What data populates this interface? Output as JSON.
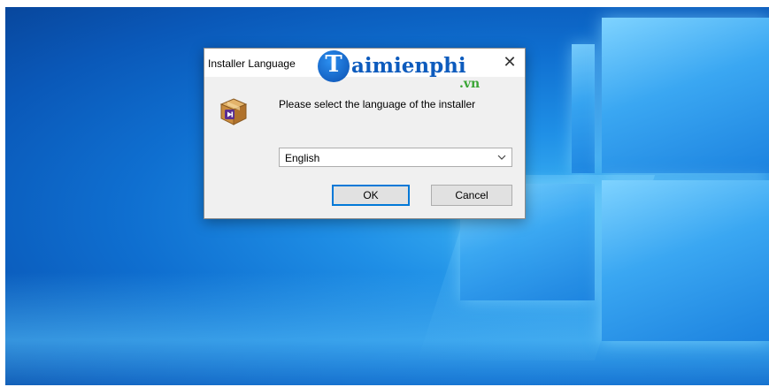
{
  "dialog": {
    "title": "Installer Language",
    "close_glyph": "✕",
    "icon": "package-icon",
    "prompt": "Please select the language of the installer",
    "language_select": {
      "value": "English"
    },
    "ok_label": "OK",
    "cancel_label": "Cancel"
  },
  "watermark": {
    "logo_letter": "T",
    "text": "aimienphi",
    "suffix": ".vn"
  },
  "colors": {
    "accent": "#0078d7",
    "wallpaper": "#0f6fd0",
    "watermark_blue": "#0d5bbd",
    "watermark_green": "#3aa635"
  }
}
